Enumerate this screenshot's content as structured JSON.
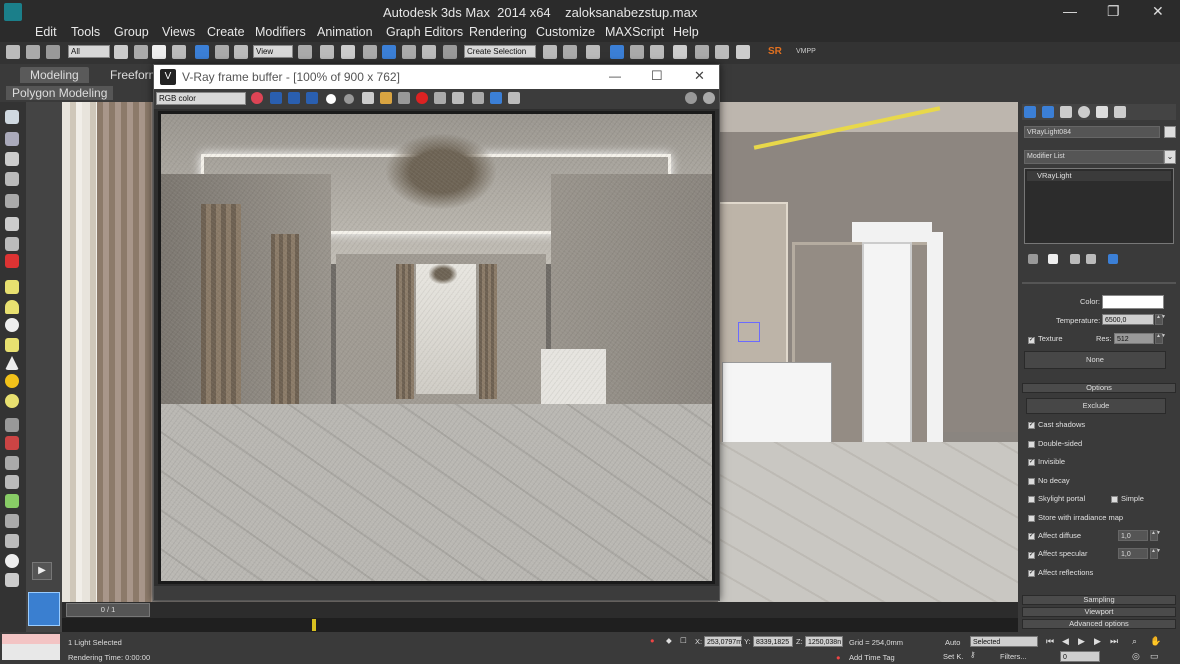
{
  "app": {
    "title": "Autodesk 3ds Max  2014 x64    zaloksanabezstup.max"
  },
  "menu": [
    "Edit",
    "Tools",
    "Group",
    "Views",
    "Create",
    "Modifiers",
    "Animation",
    "Graph Editors",
    "Rendering",
    "Customize",
    "MAXScript",
    "Help"
  ],
  "toolbar": {
    "filter_select": "All",
    "view_select": "View",
    "selection_set": "Create Selection",
    "sr_label": "SR",
    "vmpp_label": "VMPP"
  },
  "ribbon": {
    "tabs": [
      "Modeling",
      "Freeform"
    ],
    "sub_label": "Polygon Modeling"
  },
  "vfb": {
    "title": "V-Ray frame buffer - [100% of 900 x 762]",
    "channel": "RGB color"
  },
  "cmd": {
    "object_name": "VRayLight084",
    "modifier_list": "Modifier List",
    "stack_item": "VRayLight",
    "color_label": "Color:",
    "temperature_label": "Temperature:",
    "temperature_value": "6500,0",
    "texture_label": "Texture",
    "res_label": "Res:",
    "res_value": "512",
    "none_button": "None",
    "options_rollout": "Options",
    "exclude_button": "Exclude",
    "options": [
      {
        "label": "Cast shadows",
        "checked": true
      },
      {
        "label": "Double-sided",
        "checked": false
      },
      {
        "label": "Invisible",
        "checked": true
      },
      {
        "label": "No decay",
        "checked": false
      },
      {
        "label": "Skylight portal",
        "checked": false
      },
      {
        "label": "Store with irradiance map",
        "checked": false
      },
      {
        "label": "Affect diffuse",
        "checked": true
      },
      {
        "label": "Affect specular",
        "checked": true
      },
      {
        "label": "Affect reflections",
        "checked": true
      }
    ],
    "simple_label": "Simple",
    "affect_diffuse_value": "1,0",
    "affect_specular_value": "1,0",
    "rollouts_bottom": [
      "Sampling",
      "Viewport",
      "Advanced options"
    ]
  },
  "timeline": {
    "frame": "0 / 1"
  },
  "status": {
    "selected": "1 Light Selected",
    "rendering_time": "Rendering Time: 0:00:00",
    "x_label": "X:",
    "x_value": "253,0797m",
    "y_label": "Y:",
    "y_value": "8339,1825",
    "z_label": "Z:",
    "z_value": "1250,038n",
    "grid": "Grid = 254,0mm",
    "add_time_tag": "Add Time Tag",
    "auto": "Auto",
    "set_key": "Set K.",
    "selected_dd": "Selected",
    "filters": "Filters...",
    "frame_field": "0"
  }
}
